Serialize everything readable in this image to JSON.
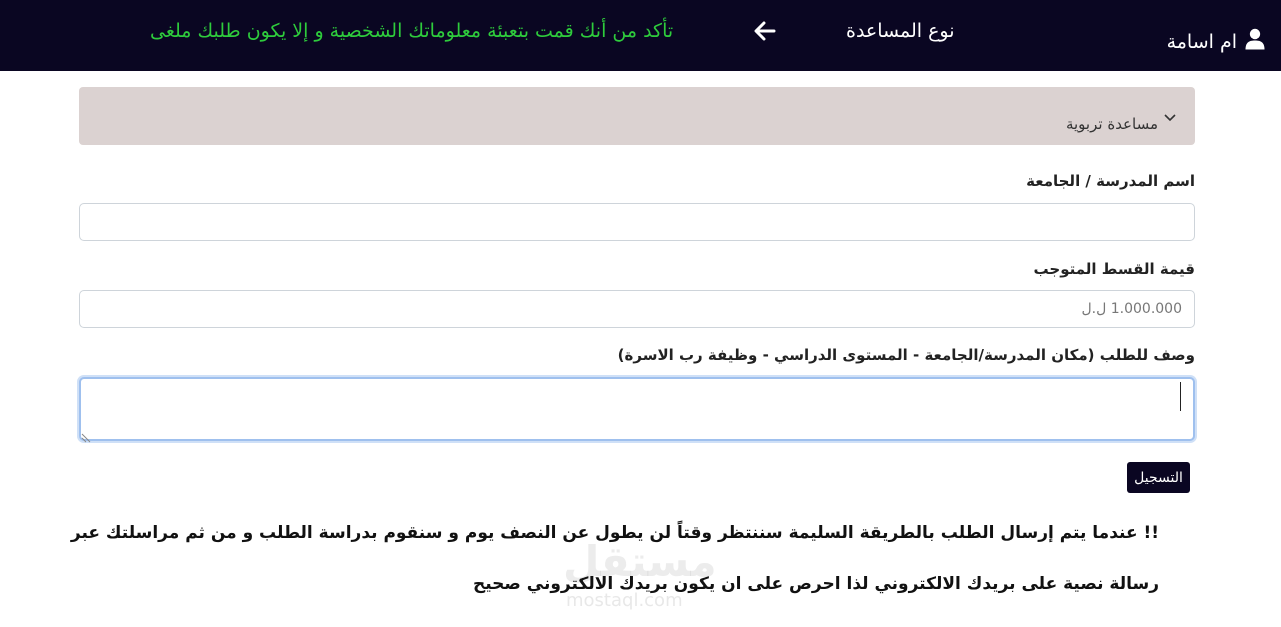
{
  "header": {
    "user_name": "ام اسامة",
    "title": "نوع المساعدة",
    "warning": "تأكد من أنك قمت بتعبئة معلوماتك الشخصية و إلا يكون طلبك ملغى",
    "warning_color": "#2ecc3c",
    "background": "#0a0622"
  },
  "form": {
    "aid_type_selected": "مساعدة تربوية",
    "school_label": "اسم المدرسة / الجامعة",
    "school_value": "",
    "installment_label": "قيمة القسط المتوجب",
    "installment_placeholder": "1.000.000 ل.ل",
    "description_label": "وصف للطلب (مكان المدرسة/الجامعة - المستوى الدراسي - وظيفة رب الاسرة)",
    "description_value": "",
    "submit_label": "التسجيل"
  },
  "notice": {
    "line1": "!! عندما يتم إرسال الطلب بالطريقة السليمة سننتظر وقتاً لن يطول عن النصف يوم و سنقوم بدراسة الطلب و من ثم مراسلتك عبر",
    "line2": "رسالة نصية على بريدك الالكتروني لذا احرص على ان يكون بريدك الالكتروني صحيح"
  },
  "watermark": {
    "main": "مستقل",
    "sub": "mostaql.com"
  },
  "icons": {
    "user": "user-icon",
    "back": "arrow-left-icon",
    "dropdown": "chevron-down-icon"
  }
}
